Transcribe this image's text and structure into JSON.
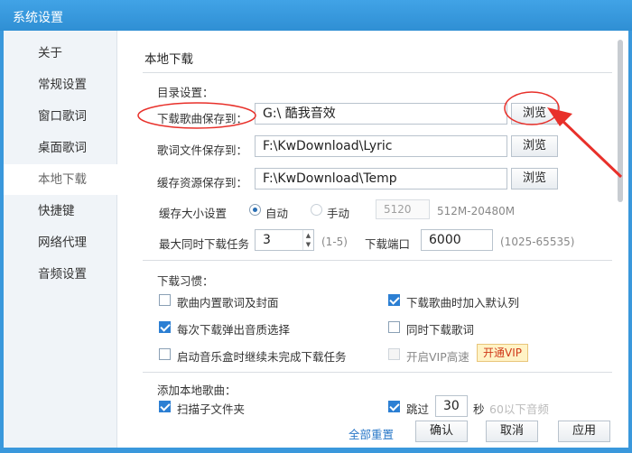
{
  "window": {
    "title": "系统设置"
  },
  "sidebar": {
    "items": [
      {
        "label": "关于"
      },
      {
        "label": "常规设置"
      },
      {
        "label": "窗口歌词"
      },
      {
        "label": "桌面歌词"
      },
      {
        "label": "本地下载",
        "active": true
      },
      {
        "label": "快捷键"
      },
      {
        "label": "网络代理"
      },
      {
        "label": "音频设置"
      }
    ]
  },
  "section": {
    "title": "本地下载"
  },
  "directory": {
    "header": "目录设置：",
    "rows": [
      {
        "label": "下载歌曲保存到：",
        "value": "G:\\ 酷我音效",
        "button": "浏览"
      },
      {
        "label": "歌词文件保存到：",
        "value": "F:\\KwDownload\\Lyric",
        "button": "浏览"
      },
      {
        "label": "缓存资源保存到：",
        "value": "F:\\KwDownload\\Temp",
        "button": "浏览"
      }
    ]
  },
  "cache": {
    "label": "缓存大小设置",
    "auto_label": "自动",
    "manual_label": "手动",
    "size_value": "5120",
    "range_hint": "512M-20480M",
    "mode": "auto"
  },
  "tasks": {
    "label": "最大同时下载任务",
    "value": "3",
    "range": "(1-5)",
    "port_label": "下载端口",
    "port_value": "6000",
    "port_range": "(1025-65535)"
  },
  "habits": {
    "header": "下载习惯：",
    "options": [
      {
        "label": "歌曲内置歌词及封面",
        "checked": false
      },
      {
        "label": "下载歌曲时加入默认列",
        "checked": true
      },
      {
        "label": "每次下载弹出音质选择",
        "checked": true
      },
      {
        "label": "同时下载歌词",
        "checked": false
      },
      {
        "label": "启动音乐盒时继续未完成下载任务",
        "checked": false
      },
      {
        "label": "开启VIP高速",
        "checked": false,
        "disabled": true
      }
    ],
    "vip_button": "开通VIP"
  },
  "add_local": {
    "header": "添加本地歌曲：",
    "scan_label": "扫描子文件夹",
    "scan_checked": true,
    "skip_label": "跳过",
    "skip_checked": true,
    "skip_value": "30",
    "skip_unit": "秒",
    "skip_tail": "60以下音频"
  },
  "footer": {
    "reset": "全部重置",
    "ok": "确认",
    "cancel": "取消",
    "apply": "应用"
  },
  "colors": {
    "accent": "#3a98dc",
    "annotation": "#e8302a"
  }
}
